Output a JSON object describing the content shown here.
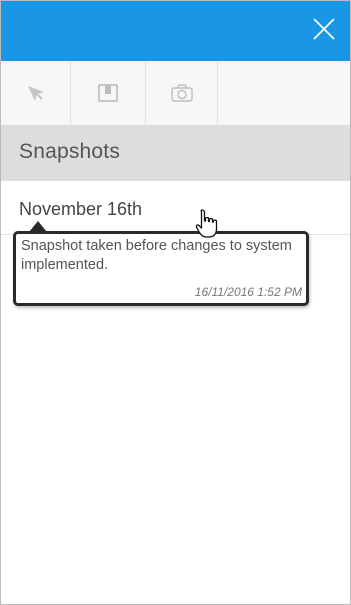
{
  "header": {
    "background_color": "#1a96e6",
    "close_icon": "close-icon"
  },
  "toolbar": {
    "tools": [
      {
        "icon": "pointer-icon"
      },
      {
        "icon": "bookmark-icon"
      },
      {
        "icon": "camera-icon"
      }
    ]
  },
  "section": {
    "title": "Snapshots"
  },
  "snapshots": [
    {
      "name": "November 16th",
      "description": "Snapshot taken before changes to system implemented.",
      "timestamp": "16/11/2016 1:52 PM"
    }
  ]
}
